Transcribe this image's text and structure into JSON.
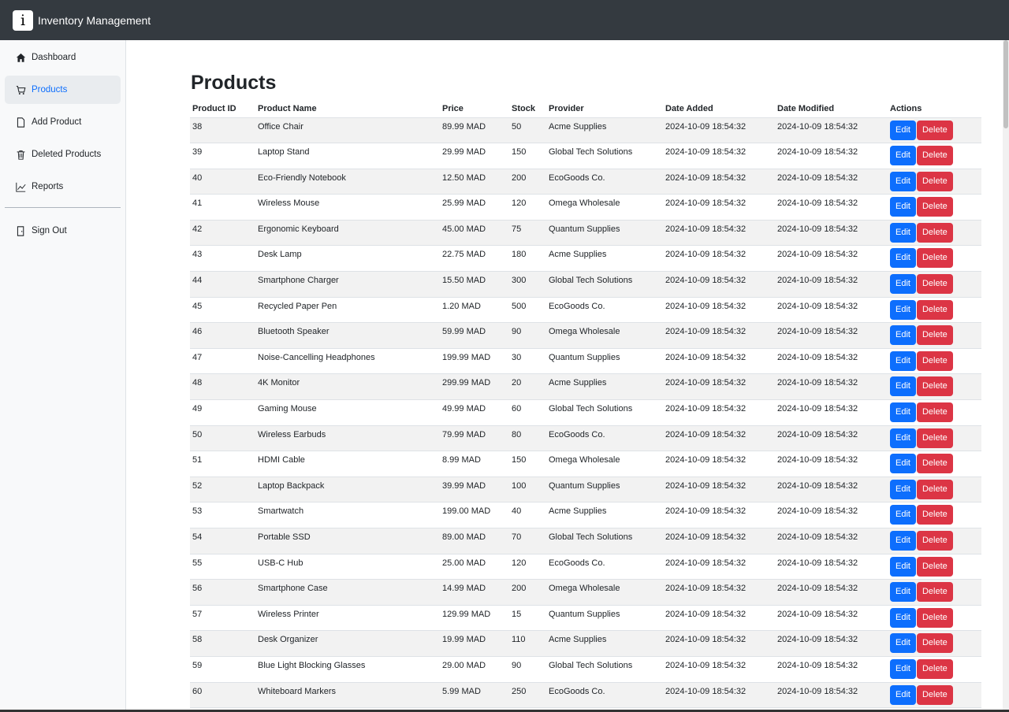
{
  "header": {
    "logo_letter": "i",
    "title": "Inventory Management"
  },
  "sidebar": {
    "items": [
      {
        "label": "Dashboard",
        "icon": "home-icon",
        "active": false
      },
      {
        "label": "Products",
        "icon": "cart-icon",
        "active": true
      },
      {
        "label": "Add Product",
        "icon": "document-icon",
        "active": false
      },
      {
        "label": "Deleted Products",
        "icon": "trash-icon",
        "active": false
      },
      {
        "label": "Reports",
        "icon": "chart-line-icon",
        "active": false
      }
    ],
    "signout": {
      "label": "Sign Out",
      "icon": "door-icon"
    }
  },
  "main": {
    "title": "Products",
    "columns": [
      "Product ID",
      "Product Name",
      "Price",
      "Stock",
      "Provider",
      "Date Added",
      "Date Modified",
      "Actions"
    ],
    "edit_label": "Edit",
    "delete_label": "Delete",
    "rows": [
      [
        "38",
        "Office Chair",
        "89.99 MAD",
        "50",
        "Acme Supplies",
        "2024-10-09 18:54:32",
        "2024-10-09 18:54:32"
      ],
      [
        "39",
        "Laptop Stand",
        "29.99 MAD",
        "150",
        "Global Tech Solutions",
        "2024-10-09 18:54:32",
        "2024-10-09 18:54:32"
      ],
      [
        "40",
        "Eco-Friendly Notebook",
        "12.50 MAD",
        "200",
        "EcoGoods Co.",
        "2024-10-09 18:54:32",
        "2024-10-09 18:54:32"
      ],
      [
        "41",
        "Wireless Mouse",
        "25.99 MAD",
        "120",
        "Omega Wholesale",
        "2024-10-09 18:54:32",
        "2024-10-09 18:54:32"
      ],
      [
        "42",
        "Ergonomic Keyboard",
        "45.00 MAD",
        "75",
        "Quantum Supplies",
        "2024-10-09 18:54:32",
        "2024-10-09 18:54:32"
      ],
      [
        "43",
        "Desk Lamp",
        "22.75 MAD",
        "180",
        "Acme Supplies",
        "2024-10-09 18:54:32",
        "2024-10-09 18:54:32"
      ],
      [
        "44",
        "Smartphone Charger",
        "15.50 MAD",
        "300",
        "Global Tech Solutions",
        "2024-10-09 18:54:32",
        "2024-10-09 18:54:32"
      ],
      [
        "45",
        "Recycled Paper Pen",
        "1.20 MAD",
        "500",
        "EcoGoods Co.",
        "2024-10-09 18:54:32",
        "2024-10-09 18:54:32"
      ],
      [
        "46",
        "Bluetooth Speaker",
        "59.99 MAD",
        "90",
        "Omega Wholesale",
        "2024-10-09 18:54:32",
        "2024-10-09 18:54:32"
      ],
      [
        "47",
        "Noise-Cancelling Headphones",
        "199.99 MAD",
        "30",
        "Quantum Supplies",
        "2024-10-09 18:54:32",
        "2024-10-09 18:54:32"
      ],
      [
        "48",
        "4K Monitor",
        "299.99 MAD",
        "20",
        "Acme Supplies",
        "2024-10-09 18:54:32",
        "2024-10-09 18:54:32"
      ],
      [
        "49",
        "Gaming Mouse",
        "49.99 MAD",
        "60",
        "Global Tech Solutions",
        "2024-10-09 18:54:32",
        "2024-10-09 18:54:32"
      ],
      [
        "50",
        "Wireless Earbuds",
        "79.99 MAD",
        "80",
        "EcoGoods Co.",
        "2024-10-09 18:54:32",
        "2024-10-09 18:54:32"
      ],
      [
        "51",
        "HDMI Cable",
        "8.99 MAD",
        "150",
        "Omega Wholesale",
        "2024-10-09 18:54:32",
        "2024-10-09 18:54:32"
      ],
      [
        "52",
        "Laptop Backpack",
        "39.99 MAD",
        "100",
        "Quantum Supplies",
        "2024-10-09 18:54:32",
        "2024-10-09 18:54:32"
      ],
      [
        "53",
        "Smartwatch",
        "199.00 MAD",
        "40",
        "Acme Supplies",
        "2024-10-09 18:54:32",
        "2024-10-09 18:54:32"
      ],
      [
        "54",
        "Portable SSD",
        "89.00 MAD",
        "70",
        "Global Tech Solutions",
        "2024-10-09 18:54:32",
        "2024-10-09 18:54:32"
      ],
      [
        "55",
        "USB-C Hub",
        "25.00 MAD",
        "120",
        "EcoGoods Co.",
        "2024-10-09 18:54:32",
        "2024-10-09 18:54:32"
      ],
      [
        "56",
        "Smartphone Case",
        "14.99 MAD",
        "200",
        "Omega Wholesale",
        "2024-10-09 18:54:32",
        "2024-10-09 18:54:32"
      ],
      [
        "57",
        "Wireless Printer",
        "129.99 MAD",
        "15",
        "Quantum Supplies",
        "2024-10-09 18:54:32",
        "2024-10-09 18:54:32"
      ],
      [
        "58",
        "Desk Organizer",
        "19.99 MAD",
        "110",
        "Acme Supplies",
        "2024-10-09 18:54:32",
        "2024-10-09 18:54:32"
      ],
      [
        "59",
        "Blue Light Blocking Glasses",
        "29.00 MAD",
        "90",
        "Global Tech Solutions",
        "2024-10-09 18:54:32",
        "2024-10-09 18:54:32"
      ],
      [
        "60",
        "Whiteboard Markers",
        "5.99 MAD",
        "250",
        "EcoGoods Co.",
        "2024-10-09 18:54:32",
        "2024-10-09 18:54:32"
      ]
    ]
  }
}
